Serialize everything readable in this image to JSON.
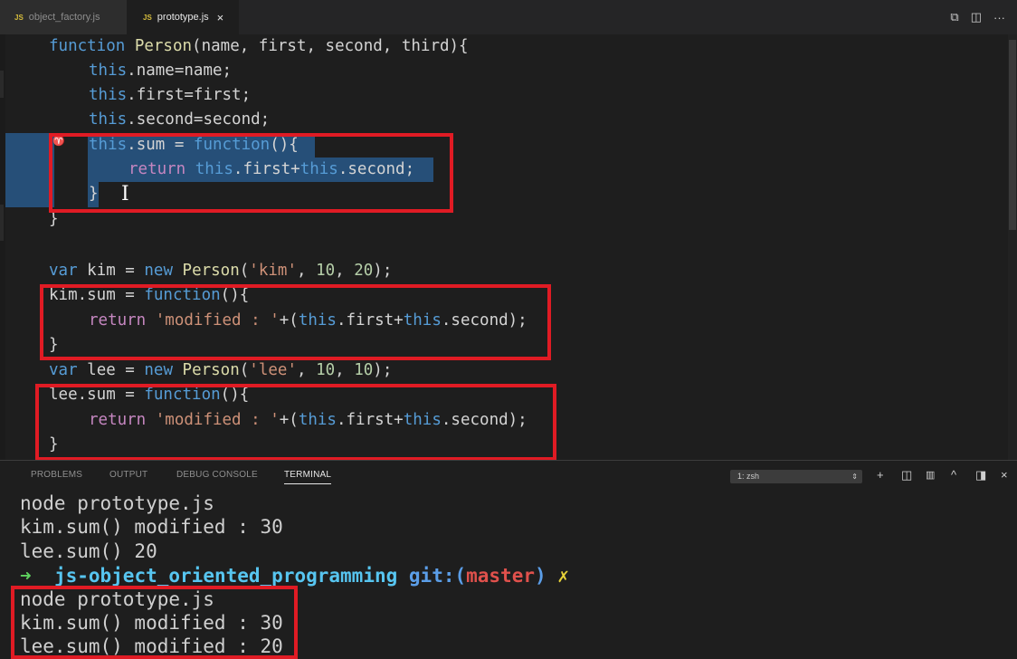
{
  "tabs": [
    {
      "icon": "JS",
      "label": "object_factory.js",
      "active": false
    },
    {
      "icon": "JS",
      "label": "prototype.js",
      "active": true,
      "close": "×"
    }
  ],
  "editor_actions": {
    "open_changes": "⧉",
    "split": "◫",
    "more": "···"
  },
  "code": {
    "l1": {
      "kw": "function ",
      "name": "Person",
      "rest": "(name, first, second, third){"
    },
    "l2": {
      "kw": "this",
      "rest": ".name=name;"
    },
    "l3": {
      "kw": "this",
      "rest": ".first=first;"
    },
    "l4": {
      "kw": "this",
      "rest": ".second=second;"
    },
    "l5": {
      "kw": "this",
      "a": ".sum = ",
      "kw2": "function",
      "b": "(){"
    },
    "l6": {
      "ret": "return ",
      "kw": "this",
      "a": ".first+",
      "kw2": "this",
      "b": ".second;"
    },
    "l7": "}",
    "l8": "}",
    "l9": {
      "kw": "var ",
      "a": "kim = ",
      "kw2": "new ",
      "fn": "Person",
      "b": "(",
      "s": "'kim'",
      "c": ", ",
      "n1": "10",
      "d": ", ",
      "n2": "20",
      "e": ");"
    },
    "l10": {
      "a": "kim.sum = ",
      "kw": "function",
      "b": "(){"
    },
    "l11": {
      "ret": "return ",
      "s": "'modified : '",
      "a": "+(",
      "kw": "this",
      "b": ".first+",
      "kw2": "this",
      "c": ".second);"
    },
    "l12": "}",
    "l13": {
      "kw": "var ",
      "a": "lee = ",
      "kw2": "new ",
      "fn": "Person",
      "b": "(",
      "s": "'lee'",
      "c": ", ",
      "n1": "10",
      "d": ", ",
      "n2": "10",
      "e": ");"
    },
    "l14": {
      "a": "lee.sum = ",
      "kw": "function",
      "b": "(){"
    },
    "l15": {
      "ret": "return ",
      "s": "'modified : '",
      "a": "+(",
      "kw": "this",
      "b": ".first+",
      "kw2": "this",
      "c": ".second);"
    },
    "l16": "}"
  },
  "panel": {
    "tabs": [
      "PROBLEMS",
      "OUTPUT",
      "DEBUG CONSOLE",
      "TERMINAL"
    ],
    "active_tab": "TERMINAL",
    "shell": "1: zsh",
    "icons": {
      "add": "+",
      "split": "◫",
      "trash": "🗑",
      "maximize": "^",
      "toggle": "◨",
      "close": "×"
    }
  },
  "terminal": {
    "lines": [
      "node prototype.js",
      "kim.sum() modified : 30",
      "lee.sum() 20"
    ],
    "prompt": {
      "arrow": "➜",
      "dir": "js-object_oriented_programming",
      "git": "git:(",
      "branch": "master",
      "git_end": ")",
      "dirty": "✗"
    },
    "lines2": [
      "node prototype.js",
      "kim.sum() modified : 30",
      "lee.sum() modified : 20"
    ]
  },
  "colors": {
    "highlight_box": "#e01b24",
    "selection": "#264f78"
  }
}
